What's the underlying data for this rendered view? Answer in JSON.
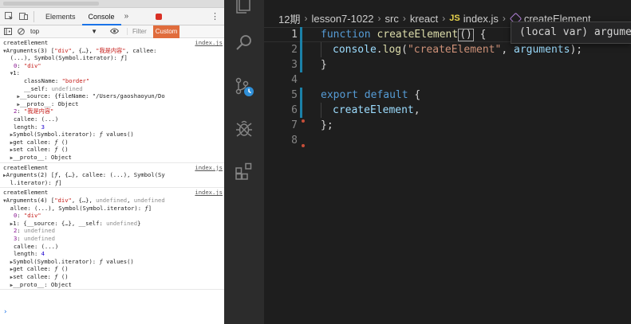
{
  "devtools": {
    "tabs": {
      "elements": "Elements",
      "console": "Console",
      "more": "»"
    },
    "toolbar": {
      "context": "top",
      "context_arrow": "▼",
      "filter_placeholder": "Filter",
      "levels": "Custom"
    },
    "messages": [
      {
        "source": "index.js",
        "lines": [
          "createElement",
          "▼Arguments(3) [\"div\", {…}, \"我是内容\", callee:",
          "  (...), Symbol(Symbol.iterator): ƒ]",
          "   0: \"div\"",
          "  ▼1:",
          "      className: \"border\"",
          "      __self: undefined",
          "    ▶__source: {fileName: \"/Users/gaoshaoyun/Do",
          "    ▶__proto__: Object",
          "   2: \"我是内容\"",
          "   callee: (...)",
          "   length: 3",
          "  ▶Symbol(Symbol.iterator): ƒ values()",
          "  ▶get callee: ƒ ()",
          "  ▶set callee: ƒ ()",
          "  ▶__proto__: Object"
        ]
      },
      {
        "source": "index.js",
        "lines": [
          "createElement",
          "▶Arguments(2) [ƒ, {…}, callee: (...), Symbol(Sy",
          "  l.iterator): ƒ]"
        ]
      },
      {
        "source": "index.js",
        "lines": [
          "createElement",
          "▼Arguments(4) [\"div\", {…}, undefined, undefined",
          "  allee: (...), Symbol(Symbol.iterator): ƒ]",
          "   0: \"div\"",
          "  ▶1: {__source: {…}, __self: undefined}",
          "   2: undefined",
          "   3: undefined",
          "   callee: (...)",
          "   length: 4",
          "  ▶Symbol(Symbol.iterator): ƒ values()",
          "  ▶get callee: ƒ ()",
          "  ▶set callee: ƒ ()",
          "  ▶__proto__: Object"
        ]
      }
    ],
    "prompt": "›"
  },
  "vscode": {
    "breadcrumb": [
      "12期",
      "lesson7-1022",
      "src",
      "kreact",
      "index.js",
      "createElement"
    ],
    "breadcrumb_js_badge": "JS",
    "tooltip": "(local var) arguments",
    "line_numbers": [
      "1",
      "2",
      "3",
      "4",
      "5",
      "6",
      "7",
      "8"
    ],
    "code": {
      "l1_kw": "function",
      "l1_fn": "createElement",
      "l1_open": "(",
      "l1_close": ")",
      "l1_brace": " {",
      "l2_obj": "console",
      "l2_dot": ".",
      "l2_method": "log",
      "l2_open": "(",
      "l2_str": "\"createElement\"",
      "l2_comma": ", ",
      "l2_arg": "arguments",
      "l2_close": ");",
      "l3": "}",
      "l5_kw1": "export",
      "l5_kw2": "default",
      "l5_brace": " {",
      "l6_fn": "createElement",
      "l6_comma": ",",
      "l7": "};"
    },
    "colors": {
      "keyword": "#569cd6",
      "function": "#dcdcaa",
      "string": "#ce9178",
      "variable": "#9cdcfe"
    }
  }
}
